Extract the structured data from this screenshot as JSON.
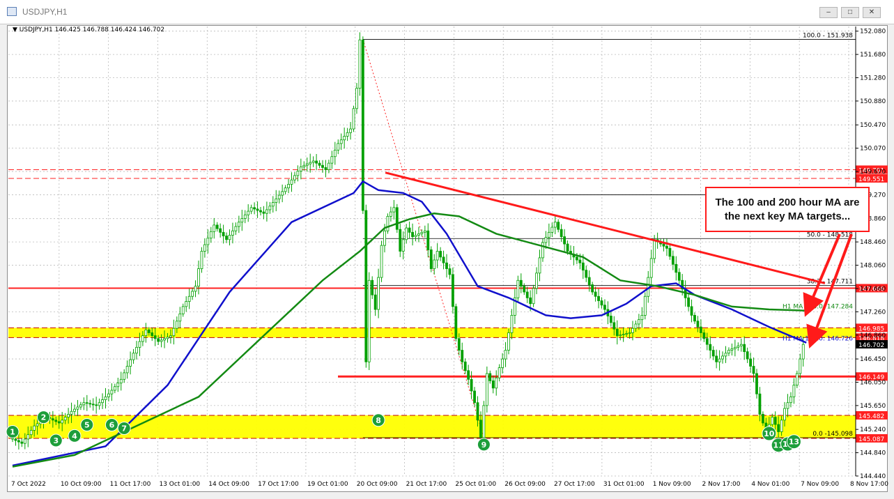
{
  "window": {
    "title": "USDJPY,H1",
    "buttons": [
      "–",
      "□",
      "✕"
    ]
  },
  "symbol_info": "▼ USDJPY,H1  146.425 146.788 146.424 146.702",
  "annotation": "The 100 and 200 hour MA are the next key MA targets...",
  "colors": {
    "candle": "#00a000",
    "ma100": "#1010cc",
    "ma200": "#138a13",
    "trendline": "#ff1a1a",
    "support": "#ff2020",
    "zone": "#ffff00",
    "marker": "#1d9e3a",
    "fib": "#000000"
  },
  "chart_data": {
    "type": "candlestick",
    "ylim": [
      144.44,
      152.16
    ],
    "y_ticks": [
      "152.080",
      "151.680",
      "151.280",
      "150.880",
      "150.470",
      "150.070",
      "149.670",
      "149.270",
      "148.860",
      "148.460",
      "148.060",
      "147.660",
      "147.260",
      "146.860",
      "146.450",
      "146.050",
      "145.650",
      "145.240",
      "144.840",
      "144.440"
    ],
    "x_labels": [
      "7 Oct 2022",
      "10 Oct 09:00",
      "11 Oct 17:00",
      "13 Oct 01:00",
      "14 Oct 09:00",
      "17 Oct 17:00",
      "19 Oct 01:00",
      "20 Oct 09:00",
      "21 Oct 17:00",
      "25 Oct 01:00",
      "26 Oct 09:00",
      "27 Oct 17:00",
      "31 Oct 01:00",
      "1 Nov 09:00",
      "2 Nov 17:00",
      "4 Nov 01:00",
      "7 Nov 09:00",
      "8 Nov 17:00"
    ],
    "price_path": [
      [
        0,
        145.1
      ],
      [
        4,
        145.0
      ],
      [
        8,
        145.3
      ],
      [
        12,
        145.45
      ],
      [
        16,
        145.35
      ],
      [
        20,
        145.55
      ],
      [
        24,
        145.7
      ],
      [
        28,
        145.65
      ],
      [
        32,
        145.85
      ],
      [
        36,
        146.1
      ],
      [
        40,
        146.55
      ],
      [
        44,
        146.95
      ],
      [
        48,
        146.75
      ],
      [
        52,
        146.85
      ],
      [
        56,
        147.35
      ],
      [
        60,
        147.7
      ],
      [
        62,
        148.3
      ],
      [
        66,
        148.75
      ],
      [
        70,
        148.5
      ],
      [
        74,
        148.8
      ],
      [
        78,
        149.05
      ],
      [
        82,
        148.95
      ],
      [
        86,
        149.2
      ],
      [
        90,
        149.45
      ],
      [
        94,
        149.75
      ],
      [
        98,
        149.85
      ],
      [
        102,
        149.7
      ],
      [
        106,
        150.15
      ],
      [
        110,
        150.4
      ],
      [
        112,
        151.1
      ],
      [
        113,
        151.93
      ],
      [
        114,
        149.0
      ],
      [
        115,
        146.4
      ],
      [
        116,
        147.8
      ],
      [
        118,
        147.3
      ],
      [
        120,
        148.4
      ],
      [
        122,
        148.9
      ],
      [
        124,
        149.05
      ],
      [
        126,
        148.3
      ],
      [
        128,
        148.7
      ],
      [
        130,
        148.55
      ],
      [
        134,
        148.65
      ],
      [
        136,
        148.0
      ],
      [
        138,
        148.3
      ],
      [
        142,
        147.9
      ],
      [
        144,
        146.8
      ],
      [
        146,
        146.4
      ],
      [
        148,
        146.1
      ],
      [
        150,
        145.7
      ],
      [
        152,
        145.1
      ],
      [
        154,
        146.2
      ],
      [
        156,
        145.95
      ],
      [
        158,
        146.3
      ],
      [
        160,
        146.6
      ],
      [
        164,
        147.8
      ],
      [
        168,
        147.4
      ],
      [
        172,
        148.45
      ],
      [
        176,
        148.8
      ],
      [
        180,
        148.3
      ],
      [
        184,
        148.1
      ],
      [
        188,
        147.6
      ],
      [
        192,
        147.3
      ],
      [
        196,
        146.85
      ],
      [
        200,
        146.9
      ],
      [
        204,
        147.2
      ],
      [
        208,
        148.5
      ],
      [
        212,
        148.35
      ],
      [
        216,
        147.8
      ],
      [
        220,
        147.2
      ],
      [
        224,
        146.8
      ],
      [
        228,
        146.4
      ],
      [
        232,
        146.6
      ],
      [
        236,
        146.7
      ],
      [
        240,
        146.2
      ],
      [
        242,
        145.5
      ],
      [
        244,
        145.2
      ],
      [
        246,
        145.45
      ],
      [
        248,
        145.2
      ],
      [
        250,
        145.6
      ],
      [
        252,
        145.8
      ],
      [
        254,
        146.2
      ],
      [
        256,
        146.7
      ]
    ],
    "series": [
      {
        "name": "H1 MA 100.0",
        "label_value": "146.726",
        "path": [
          [
            0,
            144.62
          ],
          [
            30,
            144.95
          ],
          [
            50,
            146.0
          ],
          [
            70,
            147.6
          ],
          [
            90,
            148.8
          ],
          [
            110,
            149.3
          ],
          [
            113,
            149.5
          ],
          [
            118,
            149.35
          ],
          [
            126,
            149.3
          ],
          [
            132,
            149.15
          ],
          [
            140,
            148.6
          ],
          [
            150,
            147.7
          ],
          [
            160,
            147.5
          ],
          [
            172,
            147.2
          ],
          [
            180,
            147.15
          ],
          [
            190,
            147.2
          ],
          [
            198,
            147.4
          ],
          [
            206,
            147.7
          ],
          [
            214,
            147.75
          ],
          [
            220,
            147.55
          ],
          [
            232,
            147.3
          ],
          [
            244,
            147.0
          ],
          [
            256,
            146.73
          ]
        ]
      },
      {
        "name": "H1 MA 200.0",
        "label_value": "147.284",
        "path": [
          [
            0,
            144.6
          ],
          [
            20,
            144.8
          ],
          [
            40,
            145.3
          ],
          [
            60,
            145.8
          ],
          [
            80,
            146.8
          ],
          [
            100,
            147.8
          ],
          [
            112,
            148.3
          ],
          [
            120,
            148.7
          ],
          [
            128,
            148.85
          ],
          [
            136,
            148.95
          ],
          [
            144,
            148.9
          ],
          [
            156,
            148.6
          ],
          [
            170,
            148.4
          ],
          [
            184,
            148.2
          ],
          [
            196,
            147.8
          ],
          [
            208,
            147.7
          ],
          [
            220,
            147.55
          ],
          [
            232,
            147.35
          ],
          [
            244,
            147.3
          ],
          [
            256,
            147.28
          ]
        ]
      }
    ],
    "levels": [
      {
        "value": 149.701,
        "label": "149.701",
        "style": "dashed"
      },
      {
        "value": 149.551,
        "label": "149.551",
        "style": "dashed"
      },
      {
        "value": 147.666,
        "label": "147.666",
        "style": "solid"
      },
      {
        "value": 146.985,
        "label": "146.985",
        "style": "zone-top"
      },
      {
        "value": 146.818,
        "label": "146.818",
        "style": "zone-bottom"
      },
      {
        "value": 146.149,
        "label": "146.149",
        "style": "solid"
      },
      {
        "value": 145.482,
        "label": "145.482",
        "style": "zone-top"
      },
      {
        "value": 145.087,
        "label": "145.087",
        "style": "zone-bottom"
      }
    ],
    "zones": [
      [
        146.818,
        146.985
      ],
      [
        145.087,
        145.482
      ]
    ],
    "trendline": {
      "from": [
        118,
        149.65
      ],
      "to": [
        262,
        147.75
      ]
    },
    "fibonacci": {
      "high": [
        113,
        151.938
      ],
      "low": [
        152,
        145.098
      ],
      "levels": [
        {
          "value": 151.938,
          "label": "100.0 - 151.938"
        },
        {
          "value": 149.27,
          "label": ""
        },
        {
          "value": 148.518,
          "label": "50.0 - 148.518"
        },
        {
          "value": 147.711,
          "label": "38.2 - 147.711"
        },
        {
          "value": 145.098,
          "label": "0.0 -145.098"
        }
      ]
    },
    "markers": [
      {
        "label": "1",
        "x": 0,
        "y": 145.2
      },
      {
        "label": "2",
        "x": 10,
        "y": 145.45
      },
      {
        "label": "3",
        "x": 14,
        "y": 145.05
      },
      {
        "label": "4",
        "x": 20,
        "y": 145.13
      },
      {
        "label": "5",
        "x": 24,
        "y": 145.32
      },
      {
        "label": "6",
        "x": 32,
        "y": 145.32
      },
      {
        "label": "7",
        "x": 36,
        "y": 145.26
      },
      {
        "label": "8",
        "x": 118,
        "y": 145.4
      },
      {
        "label": "9",
        "x": 152,
        "y": 144.98
      },
      {
        "label": "10",
        "x": 244,
        "y": 145.17
      },
      {
        "label": "11",
        "x": 247,
        "y": 144.97
      },
      {
        "label": "12",
        "x": 250,
        "y": 144.99
      },
      {
        "label": "13",
        "x": 252,
        "y": 145.03
      }
    ],
    "current_price": {
      "value": 146.702,
      "label": "146.702"
    }
  }
}
